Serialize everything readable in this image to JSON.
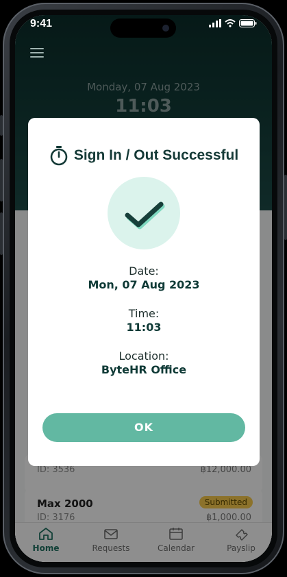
{
  "status_bar": {
    "time": "9:41"
  },
  "header": {
    "date": "Monday, 07 Aug 2023",
    "clock": "11:03"
  },
  "modal": {
    "title": "Sign In / Out Successful",
    "date_label": "Date:",
    "date_value": "Mon, 07 Aug 2023",
    "time_label": "Time:",
    "time_value": "11:03",
    "location_label": "Location:",
    "location_value": "ByteHR Office",
    "ok_label": "OK",
    "accent": "#62b8a2"
  },
  "requests": [
    {
      "id": "ID: 3536",
      "amount": "฿12,000.00"
    },
    {
      "title": "Max 2000",
      "id": "ID: 3176",
      "status": "Submitted",
      "amount": "฿1,000.00"
    }
  ],
  "tabs": [
    {
      "label": "Home",
      "icon": "home-icon"
    },
    {
      "label": "Requests",
      "icon": "envelope-icon"
    },
    {
      "label": "Calendar",
      "icon": "calendar-icon"
    },
    {
      "label": "Payslip",
      "icon": "ticket-icon"
    }
  ]
}
